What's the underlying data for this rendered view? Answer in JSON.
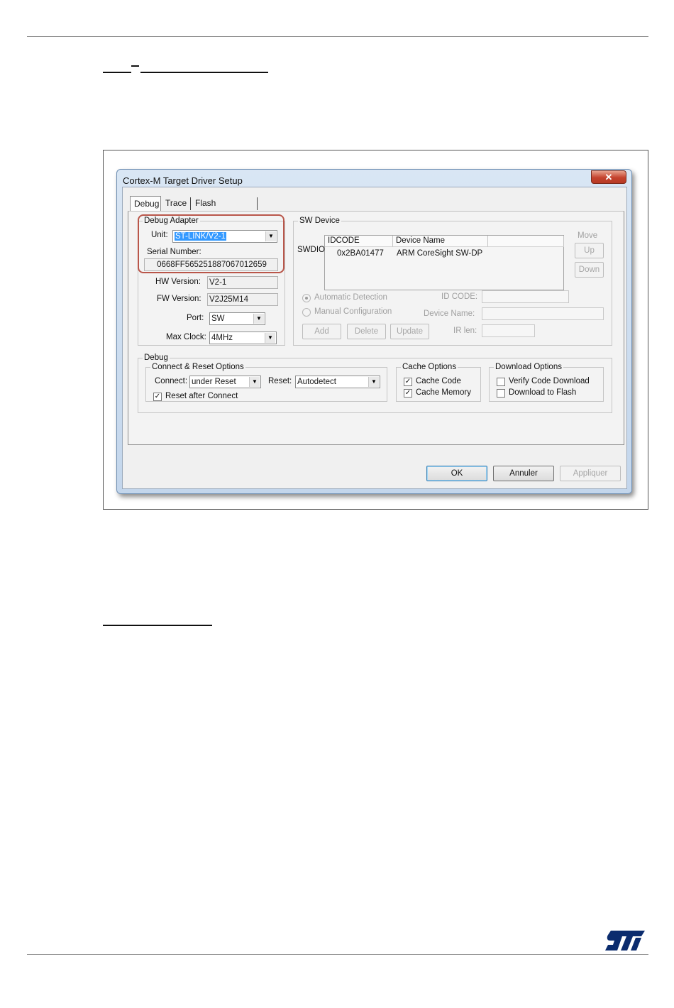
{
  "dialog": {
    "title": "Cortex-M Target Driver Setup",
    "close_glyph": "✕",
    "tabs": [
      {
        "label": "Debug",
        "active": true
      },
      {
        "label": "Trace",
        "active": false
      },
      {
        "label": "Flash Download",
        "active": false
      }
    ],
    "debug_adapter": {
      "legend": "Debug Adapter",
      "unit_label": "Unit:",
      "unit_value": "ST-LINK/V2-1",
      "serial_label": "Serial Number:",
      "serial_value": "0668FF565251887067012659",
      "hw_label": "HW Version:",
      "hw_value": "V2-1",
      "fw_label": "FW Version:",
      "fw_value": "V2J25M14",
      "port_label": "Port:",
      "port_value": "SW",
      "clock_label": "Max Clock:",
      "clock_value": "4MHz"
    },
    "sw_device": {
      "legend": "SW Device",
      "row_label": "SWDIO",
      "columns": [
        "IDCODE",
        "Device Name"
      ],
      "rows": [
        {
          "idcode": "0x2BA01477",
          "name": "ARM CoreSight SW-DP"
        }
      ],
      "move_label": "Move",
      "up_label": "Up",
      "down_label": "Down",
      "auto_detect_label": "Automatic Detection",
      "manual_config_label": "Manual Configuration",
      "idcode_label": "ID CODE:",
      "device_name_label": "Device Name:",
      "irlen_label": "IR len:",
      "add_label": "Add",
      "delete_label": "Delete",
      "update_label": "Update"
    },
    "debug": {
      "legend": "Debug",
      "connect_reset": {
        "legend": "Connect & Reset Options",
        "connect_label": "Connect:",
        "connect_value": "under Reset",
        "reset_label": "Reset:",
        "reset_value": "Autodetect",
        "reset_after_connect_label": "Reset after Connect",
        "reset_after_connect_checked": true
      },
      "cache_options": {
        "legend": "Cache Options",
        "cache_code_label": "Cache Code",
        "cache_code_checked": true,
        "cache_memory_label": "Cache Memory",
        "cache_memory_checked": true
      },
      "download_options": {
        "legend": "Download Options",
        "verify_label": "Verify Code Download",
        "verify_checked": false,
        "flash_label": "Download to Flash",
        "flash_checked": false
      }
    },
    "footer": {
      "ok_label": "OK",
      "cancel_label": "Annuler",
      "apply_label": "Appliquer"
    }
  },
  "colors": {
    "highlight": "#b9564a",
    "selection": "#3399ff",
    "close_button": "#c4422d"
  }
}
